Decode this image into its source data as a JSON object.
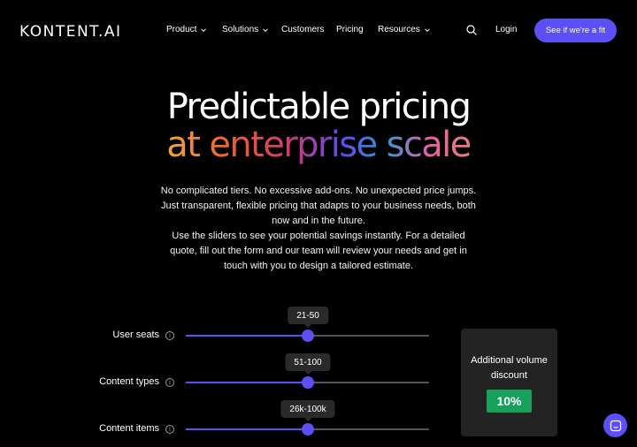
{
  "nav": {
    "logo": "KONTENT.AI",
    "items": [
      {
        "label": "Product",
        "dropdown": true
      },
      {
        "label": "Solutions",
        "dropdown": true
      },
      {
        "label": "Customers",
        "dropdown": false
      },
      {
        "label": "Pricing",
        "dropdown": false
      },
      {
        "label": "Resources",
        "dropdown": true
      }
    ],
    "search_icon": "search-icon",
    "login": "Login",
    "cta": "See if we're a fit"
  },
  "hero": {
    "title_line1": "Predictable pricing",
    "title_line2": "at enterprise scale",
    "description_1": "No complicated tiers. No excessive add-ons. No unexpected price jumps. Just transparent, flexible pricing that adapts to your business needs, both now and in the future.",
    "description_2": "Use the sliders to see your potential savings instantly. For a detailed quote, fill out the form and our team will review your needs and get in touch with you to design a tailored estimate."
  },
  "sliders": [
    {
      "label": "User seats",
      "value": "21-50",
      "fraction": 0.5
    },
    {
      "label": "Content types",
      "value": "51-100",
      "fraction": 0.5
    },
    {
      "label": "Content items",
      "value": "26k-100k",
      "fraction": 0.5
    }
  ],
  "discount": {
    "title": "Additional volume discount",
    "value": "10%"
  },
  "colors": {
    "accent": "#5b4ff5",
    "badge": "#16a05a",
    "background": "#000000"
  },
  "chat_icon": "chat-icon"
}
